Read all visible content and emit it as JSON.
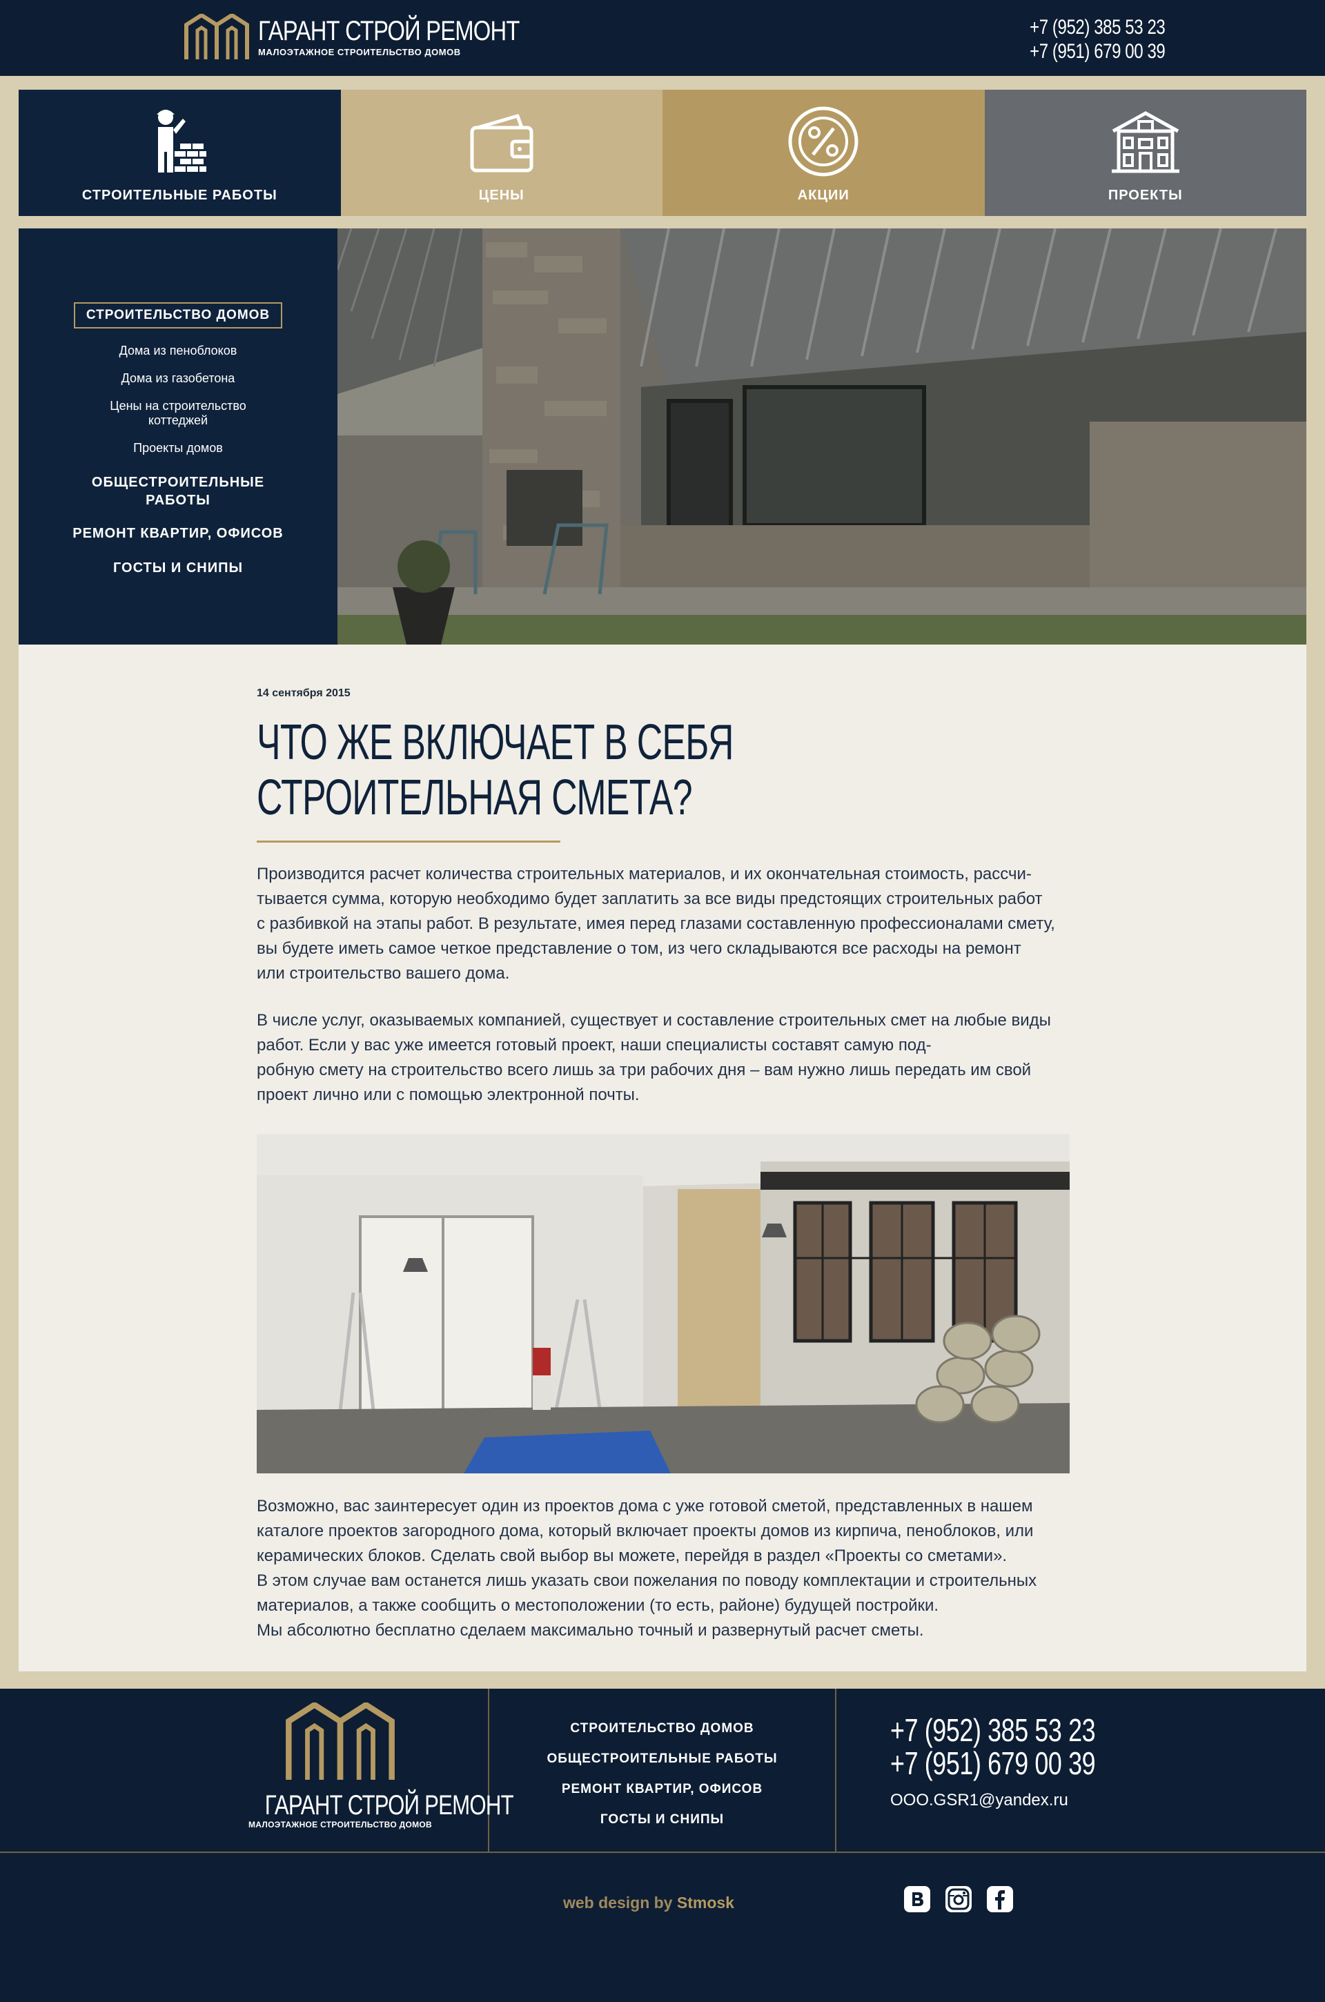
{
  "header": {
    "logo_name": "ГАРАНТ СТРОЙ РЕМОНТ",
    "logo_subtitle": "МАЛОЭТАЖНОЕ СТРОИТЕЛЬСТВО ДОМОВ",
    "phones": [
      "+7 (952) 385 53 23",
      "+7 (951) 679 00 39"
    ]
  },
  "tiles": [
    {
      "label": "СТРОИТЕЛЬНЫЕ РАБОТЫ",
      "icon": "builder-icon",
      "color": "#0f223b"
    },
    {
      "label": "ЦЕНЫ",
      "icon": "wallet-icon",
      "color": "#c7b48a"
    },
    {
      "label": "АКЦИИ",
      "icon": "percent-icon",
      "color": "#b49a62"
    },
    {
      "label": "ПРОЕКТЫ",
      "icon": "house-icon",
      "color": "#676a6f"
    }
  ],
  "side_nav": {
    "active": "СТРОИТЕЛЬСТВО ДОМОВ",
    "sub_items": [
      "Дома из пеноблоков",
      "Дома из газобетона",
      "Цены на строительство коттеджей",
      "Проекты домов"
    ],
    "main_items": [
      "ОБЩЕСТРОИТЕЛЬНЫЕ РАБОТЫ",
      "РЕМОНТ КВАРТИР, ОФИСОВ",
      "ГОСТЫ И СНИПЫ"
    ]
  },
  "article": {
    "date": "14 сентября 2015",
    "title_line1": "ЧТО ЖЕ ВКЛЮЧАЕТ В СЕБЯ",
    "title_line2": "СТРОИТЕЛЬНАЯ СМЕТА?",
    "para1": "Производится расчет количества строительных материалов, и их окончательная стоимость, рассчи-\nтывается сумма, которую необходимо будет заплатить за все виды предстоящих строительных работ\nс разбивкой на этапы работ. В результате, имея перед глазами составленную профессионалами смету,\nвы будете иметь самое четкое представление о том, из чего складываются все расходы на ремонт\nили строительство вашего дома.",
    "para2": "В числе услуг, оказываемых компанией, существует и составление строительных смет на любые виды\nработ. Если у вас уже имеется готовый проект, наши специалисты составят самую под-\nробную смету на строительство всего лишь за три рабочих дня – вам нужно лишь передать им свой\nпроект лично или с помощью электронной почты.",
    "para3": "Возможно, вас заинтересует один из проектов дома с уже готовой сметой, представленных в нашем\nкаталоге проектов загородного дома, который включает проекты домов из кирпича, пеноблоков, или\nкерамических блоков. Сделать свой выбор вы можете, перейдя в раздел «Проекты со сметами».\nВ этом случае вам останется лишь указать свои пожелания по поводу комплектации и строительных\nматериалов, а также сообщить о местоположении (то есть, районе) будущей постройки.\nМы абсолютно бесплатно сделаем максимально точный и развернутый расчет сметы."
  },
  "footer": {
    "logo_name": "ГАРАНТ СТРОЙ РЕМОНТ",
    "logo_subtitle": "МАЛОЭТАЖНОЕ СТРОИТЕЛЬСТВО ДОМОВ",
    "nav": [
      "СТРОИТЕЛЬСТВО ДОМОВ",
      "ОБЩЕСТРОИТЕЛЬНЫЕ РАБОТЫ",
      "РЕМОНТ КВАРТИР, ОФИСОВ",
      "ГОСТЫ И СНИПЫ"
    ],
    "phones": [
      "+7 (952) 385 53 23",
      "+7 (951) 679 00 39"
    ],
    "email": "OOO.GSR1@yandex.ru",
    "credit_prefix": "web design by",
    "credit_name": "Stmosk",
    "social": [
      "vk-icon",
      "instagram-icon",
      "facebook-icon"
    ]
  },
  "colors": {
    "navy": "#0d1d33",
    "gold": "#b49a62",
    "beige": "#d8ceb2",
    "paper": "#f1eee7"
  }
}
